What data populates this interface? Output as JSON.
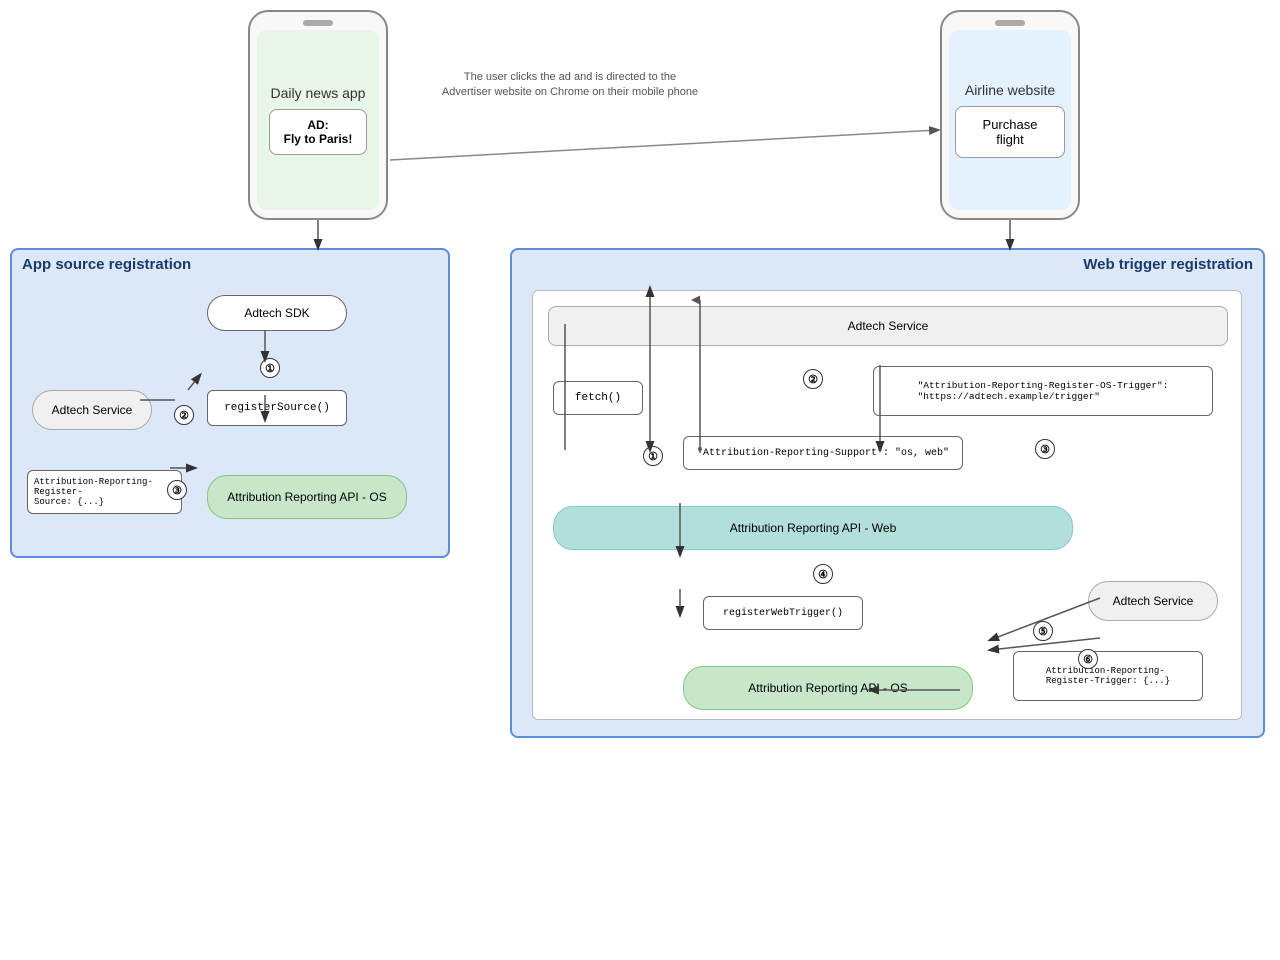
{
  "phones": {
    "left": {
      "title": "Daily news app",
      "ad_label": "AD:\nFly to Paris!",
      "color": "green"
    },
    "right": {
      "title": "Airline website",
      "action_label": "Purchase flight",
      "color": "blue"
    }
  },
  "arrow_annotation": "The user clicks the ad and is directed to\nthe Advertiser website on Chrome on\ntheir mobile phone",
  "left_box": {
    "title": "App source registration",
    "boxes": {
      "adtech_sdk": "Adtech SDK",
      "adtech_service": "Adtech Service",
      "register_source": "registerSource()",
      "api_os": "Attribution Reporting API - OS",
      "code_block": "Attribution-Reporting-Register-\nSource: {...}"
    },
    "steps": [
      "①",
      "②",
      "③"
    ]
  },
  "right_box": {
    "title": "Web trigger registration",
    "boxes": {
      "adtech_service_top": "Adtech Service",
      "fetch": "fetch()",
      "os_trigger_header": "\"Attribution-Reporting-Register-OS-Trigger\":\n\"https://adtech.example/trigger\"",
      "support_header": "\"Attribution-Reporting-Support\": \"os, web\"",
      "api_web": "Attribution Reporting API - Web",
      "register_web_trigger": "registerWebTrigger()",
      "adtech_service_right": "Adtech Service",
      "api_os": "Attribution Reporting API - OS",
      "code_block": "Attribution-Reporting-\nRegister-Trigger: {...}"
    },
    "steps": [
      "①",
      "②",
      "③",
      "④",
      "⑤",
      "⑥"
    ]
  }
}
